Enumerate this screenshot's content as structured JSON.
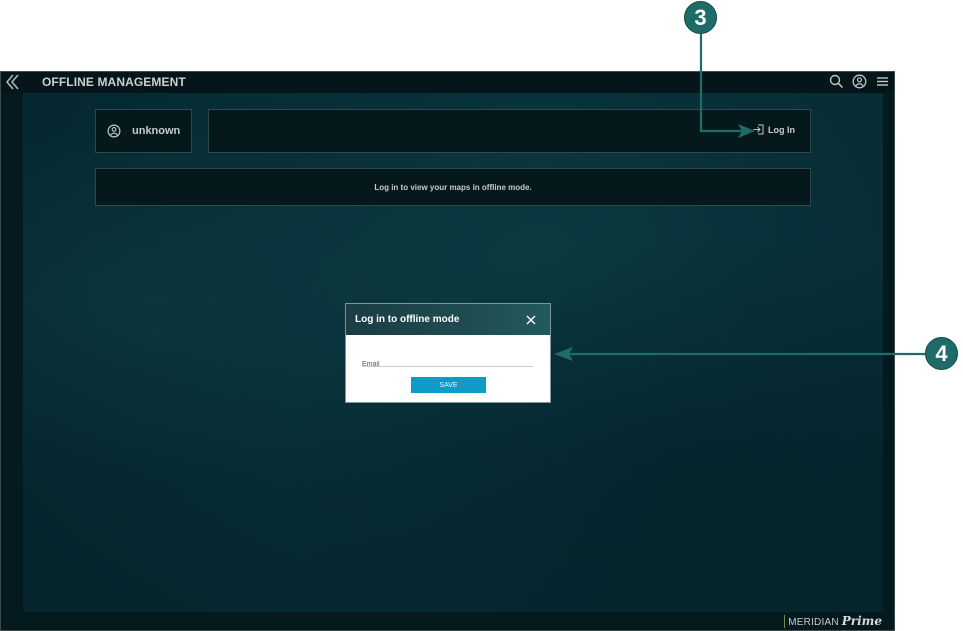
{
  "topbar": {
    "title": "OFFLINE MANAGEMENT",
    "back_icon": "double-chevron-left-icon",
    "icons": [
      "search-icon",
      "user-circle-icon",
      "hamburger-menu-icon"
    ]
  },
  "user_panel": {
    "icon": "user-circle-icon",
    "username": "unknown"
  },
  "login_panel": {
    "icon": "sign-in-icon",
    "label": "Log In"
  },
  "message": "Log in to view your maps in offline mode.",
  "dialog": {
    "title": "Log in to offline mode",
    "close_icon": "close-icon",
    "email_placeholder": "Email",
    "email_value": "",
    "save_label": "SAVE"
  },
  "brand": {
    "name": "MERIDIAN",
    "suffix": "Prime"
  },
  "annotations": [
    {
      "number": "3",
      "target": "Log In button"
    },
    {
      "number": "4",
      "target": "Log in to offline mode dialog"
    }
  ],
  "colors": {
    "accent": "#0e9bc7",
    "callout": "#1e6b68",
    "dialog_header": "#1e4c52",
    "background": "#062931"
  }
}
